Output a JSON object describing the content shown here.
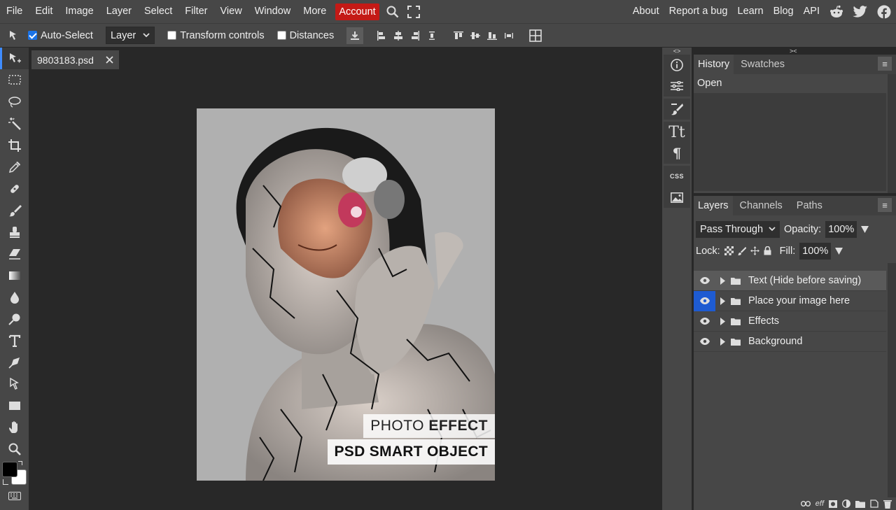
{
  "menu": {
    "items": [
      "File",
      "Edit",
      "Image",
      "Layer",
      "Select",
      "Filter",
      "View",
      "Window",
      "More"
    ],
    "account": "Account",
    "right_links": [
      "About",
      "Report a bug",
      "Learn",
      "Blog",
      "API"
    ]
  },
  "options": {
    "auto_select_label": "Auto-Select",
    "auto_select_checked": true,
    "layer_select": "Layer",
    "transform_label": "Transform controls",
    "distances_label": "Distances"
  },
  "document": {
    "tab_name": "9803183.psd"
  },
  "canvas_text": {
    "line1_normal": "PHOTO ",
    "line1_bold": "EFFECT",
    "line2": "PSD SMART OBJECT"
  },
  "history_panel": {
    "tabs": [
      "History",
      "Swatches"
    ],
    "entries": [
      "Open"
    ]
  },
  "layers_panel": {
    "tabs": [
      "Layers",
      "Channels",
      "Paths"
    ],
    "blend_mode": "Pass Through",
    "opacity_label": "Opacity:",
    "opacity_value": "100%",
    "lock_label": "Lock:",
    "fill_label": "Fill:",
    "fill_value": "100%",
    "layers": [
      {
        "name": "Text (Hide before saving)"
      },
      {
        "name": "Place your image here"
      },
      {
        "name": "Effects"
      },
      {
        "name": "Background"
      }
    ]
  },
  "colors": {
    "accent": "#1e5bd1",
    "account_bg": "#c41a16",
    "foreground": "#000000",
    "background": "#ffffff"
  }
}
